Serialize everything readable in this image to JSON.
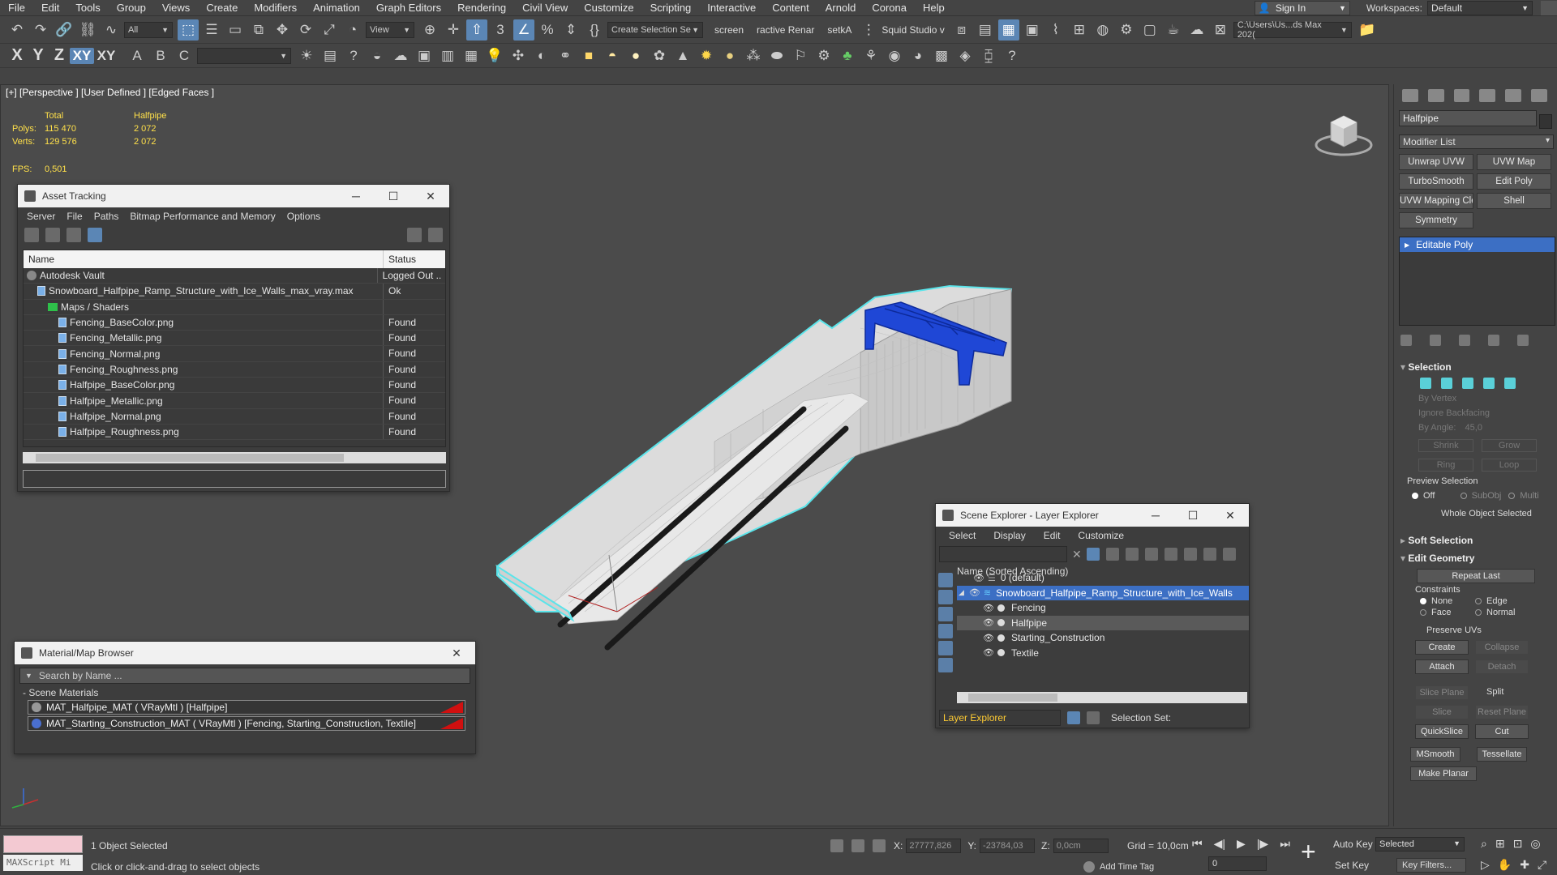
{
  "menu": [
    "File",
    "Edit",
    "Tools",
    "Group",
    "Views",
    "Create",
    "Modifiers",
    "Animation",
    "Graph Editors",
    "Rendering",
    "Civil View",
    "Customize",
    "Scripting",
    "Interactive",
    "Content",
    "Arnold",
    "Corona",
    "Help"
  ],
  "signin": "Sign In",
  "workspaces_label": "Workspaces:",
  "workspaces_value": "Default",
  "toolbar": {
    "filter": "All",
    "view": "View",
    "selection_set": "Create Selection Se",
    "script1": "screen",
    "script2": "ractive Renar",
    "script3": "setkA",
    "script4": "Squid Studio v",
    "path": "C:\\Users\\Us...ds Max 202("
  },
  "axes": [
    "X",
    "Y",
    "Z",
    "XY",
    "XY"
  ],
  "viewport": {
    "label": "[+] [Perspective ] [User Defined ] [Edged Faces ]",
    "stats_head": [
      "Total",
      "Halfpipe"
    ],
    "polys": [
      "Polys:",
      "115 470",
      "2 072"
    ],
    "verts": [
      "Verts:",
      "129 576",
      "2 072"
    ],
    "fps": [
      "FPS:",
      "0,501"
    ]
  },
  "asset_tracking": {
    "title": "Asset Tracking",
    "menu": [
      "Server",
      "File",
      "Paths",
      "Bitmap Performance and Memory",
      "Options"
    ],
    "col_name": "Name",
    "col_status": "Status",
    "rows": [
      {
        "name": "Autodesk Vault",
        "status": "Logged Out ..",
        "level": 1,
        "icon": "vault"
      },
      {
        "name": "Snowboard_Halfpipe_Ramp_Structure_with_Ice_Walls_max_vray.max",
        "status": "Ok",
        "level": 2,
        "icon": "file"
      },
      {
        "name": "Maps / Shaders",
        "status": "",
        "level": 3,
        "icon": "maps"
      },
      {
        "name": "Fencing_BaseColor.png",
        "status": "Found",
        "level": 4,
        "icon": "file"
      },
      {
        "name": "Fencing_Metallic.png",
        "status": "Found",
        "level": 4,
        "icon": "file"
      },
      {
        "name": "Fencing_Normal.png",
        "status": "Found",
        "level": 4,
        "icon": "file"
      },
      {
        "name": "Fencing_Roughness.png",
        "status": "Found",
        "level": 4,
        "icon": "file"
      },
      {
        "name": "Halfpipe_BaseColor.png",
        "status": "Found",
        "level": 4,
        "icon": "file"
      },
      {
        "name": "Halfpipe_Metallic.png",
        "status": "Found",
        "level": 4,
        "icon": "file"
      },
      {
        "name": "Halfpipe_Normal.png",
        "status": "Found",
        "level": 4,
        "icon": "file"
      },
      {
        "name": "Halfpipe_Roughness.png",
        "status": "Found",
        "level": 4,
        "icon": "file"
      }
    ]
  },
  "material_browser": {
    "title": "Material/Map Browser",
    "search_placeholder": "Search by Name ...",
    "group": "- Scene Materials",
    "items": [
      "MAT_Halfpipe_MAT  ( VRayMtl )  [Halfpipe]",
      "MAT_Starting_Construction_MAT  ( VRayMtl )  [Fencing, Starting_Construction, Textile]"
    ]
  },
  "scene_explorer": {
    "title": "Scene Explorer - Layer Explorer",
    "menu": [
      "Select",
      "Display",
      "Edit",
      "Customize"
    ],
    "header": "Name (Sorted Ascending)",
    "rows": [
      {
        "name": "0 (default)",
        "indent": 1,
        "state": ""
      },
      {
        "name": "Snowboard_Halfpipe_Ramp_Structure_with_Ice_Walls",
        "indent": 1,
        "state": "sel"
      },
      {
        "name": "Fencing",
        "indent": 2,
        "state": ""
      },
      {
        "name": "Halfpipe",
        "indent": 2,
        "state": "hl"
      },
      {
        "name": "Starting_Construction",
        "indent": 2,
        "state": ""
      },
      {
        "name": "Textile",
        "indent": 2,
        "state": ""
      }
    ],
    "layer_explorer": "Layer Explorer",
    "selection_set": "Selection Set:"
  },
  "command_panel": {
    "object_name": "Halfpipe",
    "modifier_list": "Modifier List",
    "buttons": [
      "Unwrap UVW",
      "UVW Map",
      "TurboSmooth",
      "Edit Poly",
      "UVW Mapping Clear",
      "Shell",
      "Symmetry"
    ],
    "stack_item": "Editable Poly",
    "selection_title": "Selection",
    "by_vertex": "By Vertex",
    "ignore_backfacing": "Ignore Backfacing",
    "by_angle": "By Angle:",
    "angle_value": "45,0",
    "shrink": "Shrink",
    "grow": "Grow",
    "ring": "Ring",
    "loop": "Loop",
    "preview_selection": "Preview Selection",
    "off": "Off",
    "subobj": "SubObj",
    "multi": "Multi",
    "whole_object": "Whole Object Selected",
    "soft_selection": "Soft Selection",
    "edit_geometry": "Edit Geometry",
    "repeat_last": "Repeat Last",
    "constraints": "Constraints",
    "none": "None",
    "edge": "Edge",
    "face": "Face",
    "normal": "Normal",
    "preserve_uvs": "Preserve UVs",
    "create": "Create",
    "collapse": "Collapse",
    "attach": "Attach",
    "detach": "Detach",
    "slice_plane": "Slice Plane",
    "split": "Split",
    "slice": "Slice",
    "reset_plane": "Reset Plane",
    "quickslice": "QuickSlice",
    "cut": "Cut",
    "msmooth": "MSmooth",
    "tessellate": "Tessellate",
    "make_planar": "Make Planar"
  },
  "status": {
    "maxscript": "MAXScript Mi",
    "selected": "1 Object Selected",
    "hint": "Click or click-and-drag to select objects",
    "x_label": "X:",
    "x_value": "27777,826",
    "y_label": "Y:",
    "y_value": "-23784,03",
    "z_label": "Z:",
    "z_value": "0,0cm",
    "grid": "Grid = 10,0cm",
    "add_time_tag": "Add Time Tag",
    "frame": "0",
    "auto_key": "Auto Key",
    "set_key": "Set Key",
    "selected_dd": "Selected",
    "key_filters": "Key Filters..."
  }
}
